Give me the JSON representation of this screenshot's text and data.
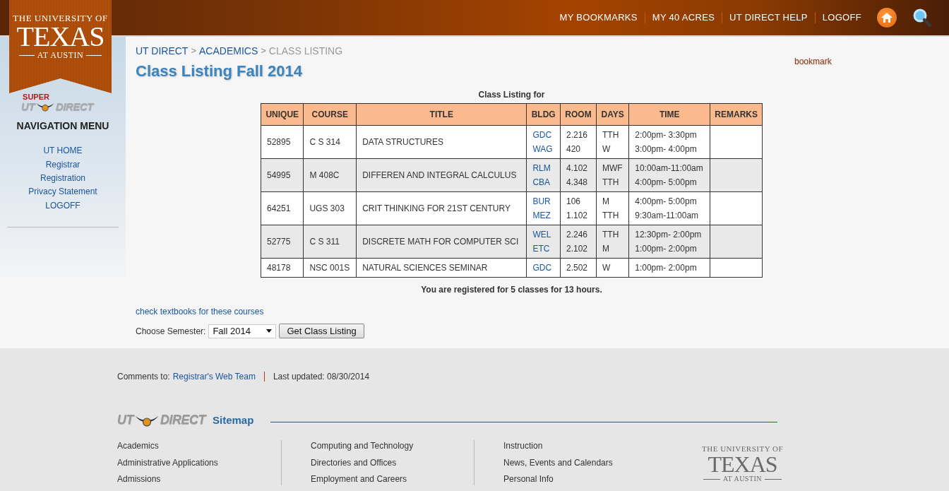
{
  "header": {
    "logo": {
      "top": "THE UNIVERSITY OF",
      "main": "TEXAS",
      "bottom": "AT AUSTIN"
    },
    "nav": [
      "MY BOOKMARKS",
      "MY 40 ACRES",
      "UT DIRECT HELP",
      "LOGOFF"
    ]
  },
  "sidebar": {
    "badge": {
      "super": "SUPER",
      "left": "UT",
      "right": "DIRECT"
    },
    "heading": "NAVIGATION MENU",
    "links": [
      "UT HOME",
      "Registrar",
      "Registration",
      "Privacy Statement",
      "LOGOFF"
    ]
  },
  "breadcrumb": {
    "separator": ">",
    "items": [
      {
        "label": "UT DIRECT",
        "current": false
      },
      {
        "label": "ACADEMICS",
        "current": false
      },
      {
        "label": "CLASS LISTING",
        "current": true
      }
    ]
  },
  "page_title": "Class Listing Fall 2014",
  "bookmark_link": "bookmark",
  "table": {
    "caption": "Class Listing for",
    "columns": [
      "UNIQUE",
      "COURSE",
      "TITLE",
      "BLDG",
      "ROOM",
      "DAYS",
      "TIME",
      "REMARKS"
    ],
    "rows": [
      {
        "unique": "52895",
        "course": "C S 314",
        "title": "DATA STRUCTURES",
        "meetings": [
          {
            "bldg": "GDC",
            "room": "2.216",
            "days": "TTH",
            "time": "2:00pm- 3:30pm"
          },
          {
            "bldg": "WAG",
            "room": "420",
            "days": "W",
            "time": "3:00pm- 4:00pm"
          }
        ]
      },
      {
        "unique": "54995",
        "course": "M 408C",
        "title": "DIFFEREN AND INTEGRAL CALCULUS",
        "meetings": [
          {
            "bldg": "RLM",
            "room": "4.102",
            "days": "MWF",
            "time": "10:00am-11:00am"
          },
          {
            "bldg": "CBA",
            "room": "4.348",
            "days": "TTH",
            "time": "4:00pm- 5:00pm"
          }
        ]
      },
      {
        "unique": "64251",
        "course": "UGS 303",
        "title": "CRIT THINKING FOR 21ST CENTURY",
        "meetings": [
          {
            "bldg": "BUR",
            "room": "106",
            "days": "M",
            "time": "4:00pm- 5:00pm"
          },
          {
            "bldg": "MEZ",
            "room": "1.102",
            "days": "TTH",
            "time": "9:30am-11:00am"
          }
        ]
      },
      {
        "unique": "52775",
        "course": "C S 311",
        "title": "DISCRETE MATH FOR COMPUTER SCI",
        "meetings": [
          {
            "bldg": "WEL",
            "room": "2.246",
            "days": "TTH",
            "time": "12:30pm- 2:00pm"
          },
          {
            "bldg": "ETC",
            "room": "2.102",
            "days": "M",
            "time": "1:00pm- 2:00pm"
          }
        ]
      },
      {
        "unique": "48178",
        "course": "NSC 001S",
        "title": "NATURAL SCIENCES SEMINAR",
        "meetings": [
          {
            "bldg": "GDC",
            "room": "2.502",
            "days": "W",
            "time": "1:00pm- 2:00pm"
          }
        ]
      }
    ]
  },
  "summary": "You are registered for 5 classes for 13 hours.",
  "textbooks_link": "check textbooks for these courses",
  "semester": {
    "label": "Choose Semester:",
    "value": "Fall 2014",
    "button": "Get Class Listing"
  },
  "footer": {
    "comments_label": "Comments to:",
    "comments_link": "Registrar's Web Team",
    "updated": "Last updated: 08/30/2014",
    "badge": {
      "left": "UT",
      "right": "DIRECT"
    },
    "sitemap_title": "Sitemap",
    "columns": [
      [
        "Academics",
        "Administrative Applications",
        "Admissions"
      ],
      [
        "Computing and Technology",
        "Directories and Offices",
        "Employment and Careers"
      ],
      [
        "Instruction",
        "News, Events and Calendars",
        "Personal Info"
      ]
    ],
    "logo": {
      "top": "THE UNIVERSITY OF",
      "main": "TEXAS",
      "bottom": "AT AUSTIN"
    }
  }
}
